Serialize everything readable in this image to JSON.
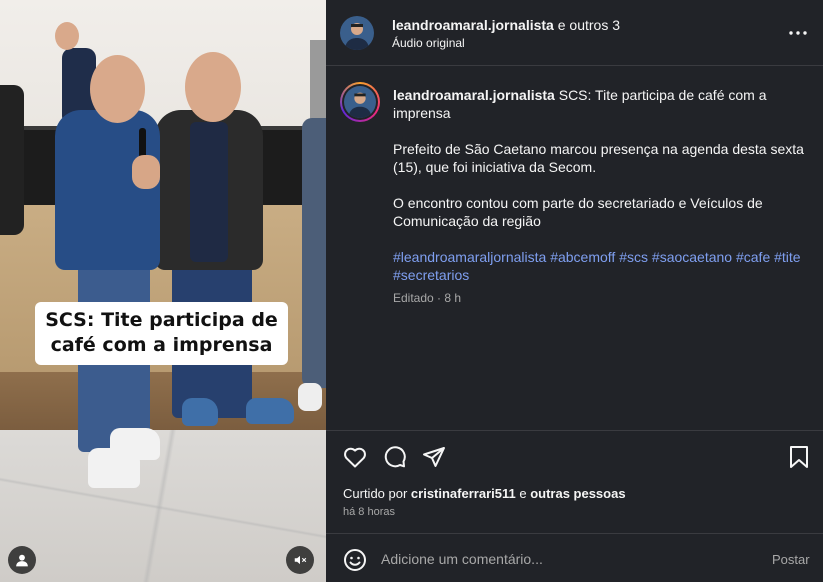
{
  "media": {
    "overlay_caption": "SCS: Tite participa de café com a imprensa",
    "user_tag_icon": "user-icon",
    "mute_icon": "speaker-muted-icon"
  },
  "header": {
    "username": "leandroamaral.jornalista",
    "coauthors": " e outros 3",
    "audio": "Áudio original",
    "more_icon": "more-horizontal-icon"
  },
  "post": {
    "author": "leandroamaral.jornalista",
    "title": " SCS: Tite participa de café com a imprensa",
    "paragraph1": "Prefeito de São Caetano marcou presença na agenda desta sexta (15), que foi iniciativa da Secom.",
    "paragraph2": "O encontro contou com parte do secretariado e Veículos de Comunicação da região",
    "hashtags": [
      "#leandroamaraljornalista",
      "#abcemoff",
      "#scs",
      "#saocaetano",
      "#cafe",
      "#tite",
      "#secretarios"
    ],
    "edited": "Editado · 8 h"
  },
  "actions": {
    "like_icon": "heart-icon",
    "comment_icon": "comment-icon",
    "share_icon": "send-icon",
    "save_icon": "bookmark-icon"
  },
  "likes": {
    "prefix": "Curtido por ",
    "user": "cristinaferrari511",
    "middle": " e ",
    "others": "outras pessoas"
  },
  "time": "há 8 horas",
  "comment": {
    "emoji_icon": "emoji-icon",
    "placeholder": "Adicione um comentário...",
    "post_label": "Postar"
  },
  "colors": {
    "panel_bg": "#212328",
    "hashtag": "#7f9ff0",
    "muted_text": "#a8a8a8"
  }
}
